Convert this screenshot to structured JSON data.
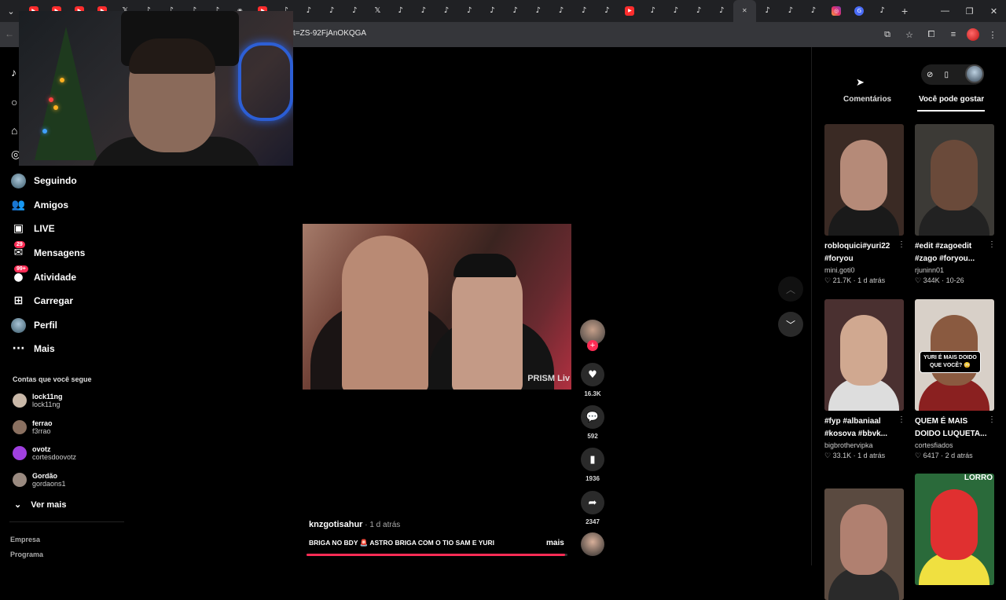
{
  "browser": {
    "tabs": [
      "yt",
      "yt",
      "yt",
      "yt",
      "x",
      "tt",
      "tt",
      "tt",
      "tt",
      "ext",
      "yt",
      "tt",
      "tt",
      "tt",
      "tt",
      "x",
      "tt",
      "tt",
      "tt",
      "tt",
      "tt",
      "tt",
      "tt",
      "tt",
      "tt",
      "tt",
      "yt",
      "tt",
      "tt",
      "tt",
      "tt",
      "active",
      "tt",
      "tt",
      "tt",
      "ig",
      "gem",
      "tt"
    ],
    "tab_icons": {
      "yt": "▶",
      "tt": "♪",
      "x": "𝕏",
      "ext": "◉",
      "ig": "◎",
      "gem": "G",
      "active": "✕"
    },
    "new_tab": "+",
    "url": "t=ZS-92FjAnOKQGA",
    "window_controls": [
      "—",
      "❐",
      "✕"
    ],
    "toolbar_icons": [
      "⧉",
      "☆",
      "⧠",
      "≡"
    ]
  },
  "sidebar": {
    "items": [
      {
        "label": "Seguindo",
        "icon": "avatar"
      },
      {
        "label": "Amigos",
        "icon": "👥"
      },
      {
        "label": "LIVE",
        "icon": "▣"
      },
      {
        "label": "Mensagens",
        "icon": "✉",
        "badge": "29"
      },
      {
        "label": "Atividade",
        "icon": "●",
        "badge": "99+"
      },
      {
        "label": "Carregar",
        "icon": "⊞"
      },
      {
        "label": "Perfil",
        "icon": "avatar"
      },
      {
        "label": "Mais",
        "icon": "···"
      }
    ],
    "following_heading": "Contas que você segue",
    "following": [
      {
        "name": "lock11ng",
        "handle": "lock11ng",
        "color": "#c9b8a8"
      },
      {
        "name": "ferrao",
        "handle": "f3rrao",
        "color": "#8a7060"
      },
      {
        "name": "ovotz",
        "handle": "cortesdoovotz",
        "color": "#a040e0"
      },
      {
        "name": "Gordão",
        "handle": "gordaons1",
        "color": "#9a8a80"
      }
    ],
    "see_more": "Ver mais",
    "footer": [
      "Empresa",
      "Programa"
    ]
  },
  "video": {
    "watermark": "PRISM Liv",
    "author": "knzgotisahur",
    "time": " · 1 d atrás",
    "caption": "BRIGA NO BDY 🚨 ASTRO BRIGA COM O TIO SAM E YURI",
    "more": "mais",
    "progress": 0.99,
    "likes": "16.3K",
    "comments": "592",
    "saves": "1936",
    "shares": "2347",
    "icons": {
      "like": "♥",
      "comment": "💬",
      "save": "▮",
      "share": "➦",
      "up": "︿",
      "down": "﹀",
      "plus": "+"
    }
  },
  "right_panel": {
    "tabs": [
      "Comentários",
      "Você pode gostar"
    ],
    "active_tab": "Você pode gostar",
    "icons": [
      "⊘",
      "▯"
    ],
    "cards": [
      {
        "title": "robloquici#yuri22 #foryou",
        "author": "mini.goti0",
        "likes": "21.7K",
        "time": "1 d atrás",
        "bg": "#3a2a24",
        "face": "#b58a78",
        "body": "#1a1a1a"
      },
      {
        "title": "#edit #zagoedit #zago #foryou...",
        "author": "rjuninn01",
        "likes": "344K",
        "time": "10-26",
        "bg": "#3c3a36",
        "face": "#6a4a3a",
        "body": "#222"
      },
      {
        "title": "#fyp #albaniaal #kosova #bbvk...",
        "author": "bigbrothervipka",
        "likes": "33.1K",
        "time": "1 d atrás",
        "bg": "#4a3030",
        "face": "#d0a890",
        "body": "#ddd"
      },
      {
        "title": "QUEM É MAIS DOIDO LUQUETA...",
        "author": "cortesfiados",
        "likes": "6417",
        "time": "2 d atrás",
        "bg": "#d8d0c8",
        "face": "#8a5a40",
        "body": "#8a2020",
        "overlay": "YURI É MAIS DOIDO QUE VOCÊ? 😳"
      },
      {
        "title": "",
        "author": "",
        "likes": "",
        "time": "",
        "bg": "#5a4a40",
        "face": "#b08070",
        "body": "#2a2a2a"
      },
      {
        "title": "",
        "author": "",
        "likes": "",
        "time": "",
        "bg": "#2a6a3a",
        "face": "#e03030",
        "body": "#f0e040",
        "top": "LORRO"
      }
    ]
  },
  "colors": {
    "accent": "#fe2c55",
    "bg": "#000000"
  }
}
